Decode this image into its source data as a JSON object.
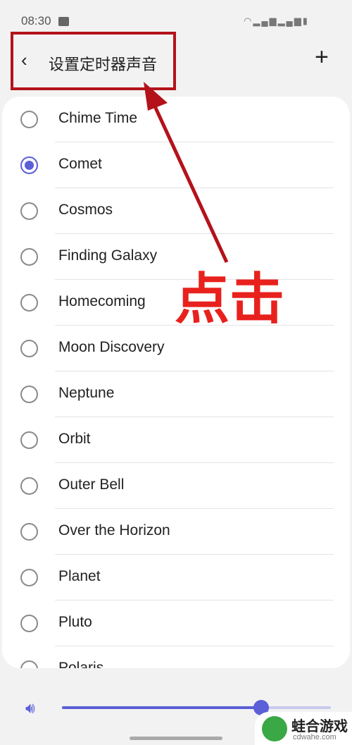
{
  "status": {
    "time": "08:30",
    "icons": [
      "image-icon",
      "wifi-icon",
      "signal-icon",
      "signal-icon",
      "battery-icon"
    ]
  },
  "header": {
    "title": "设置定时器声音",
    "back": "‹",
    "add": "+"
  },
  "sounds": [
    {
      "label": "Chime Time",
      "selected": false
    },
    {
      "label": "Comet",
      "selected": true
    },
    {
      "label": "Cosmos",
      "selected": false
    },
    {
      "label": "Finding Galaxy",
      "selected": false
    },
    {
      "label": "Homecoming",
      "selected": false
    },
    {
      "label": "Moon Discovery",
      "selected": false
    },
    {
      "label": "Neptune",
      "selected": false
    },
    {
      "label": "Orbit",
      "selected": false
    },
    {
      "label": "Outer Bell",
      "selected": false
    },
    {
      "label": "Over the Horizon",
      "selected": false
    },
    {
      "label": "Planet",
      "selected": false
    },
    {
      "label": "Pluto",
      "selected": false
    },
    {
      "label": "Polaris",
      "selected": false
    }
  ],
  "volume": {
    "icon": "speaker-icon",
    "level": 0.74
  },
  "annotation": {
    "text": "点击",
    "color": "#e8211d"
  },
  "watermark": {
    "name": "蛙合游戏",
    "url": "cdwahe.com"
  },
  "colors": {
    "accent": "#5b5fd8",
    "annotation_box": "#b4121b"
  }
}
